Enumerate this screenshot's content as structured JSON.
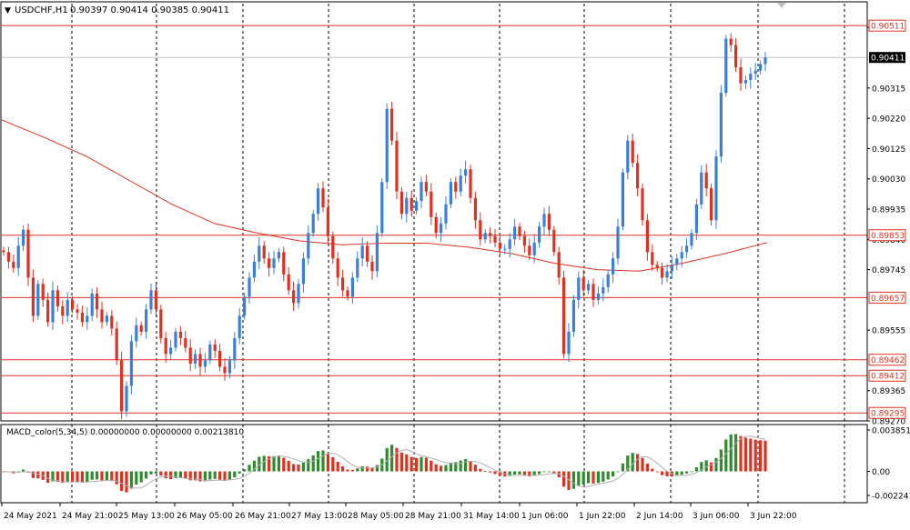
{
  "header": {
    "symbol_label": "USDCHF,H1",
    "ohlc_label": "0.90397 0.90414 0.90385 0.90411"
  },
  "macd": {
    "label": "MACD_color(5,34,5) 0.00000000 0.00000000 0.00213810",
    "ticks": [
      {
        "label": "0.0038515",
        "value": 0.0038515
      },
      {
        "label": "0.00",
        "value": 0.0
      },
      {
        "label": "-0.0022415",
        "value": -0.0022415
      }
    ]
  },
  "colors": {
    "up": "#3b7fd9",
    "down": "#e03020",
    "ma": "#e03020",
    "level": "#e03020",
    "hist_up": "#2e8b2e",
    "hist_down": "#e03020",
    "signal": "#b0b0b0",
    "grid": "#000000"
  },
  "chart_data": {
    "type": "candlestick",
    "ylim": [
      0.8927,
      0.9058
    ],
    "price_ticks": [
      {
        "label": "0.90505",
        "value": 0.90505
      },
      {
        "label": "0.90315",
        "value": 0.90315
      },
      {
        "label": "0.90220",
        "value": 0.9022
      },
      {
        "label": "0.90125",
        "value": 0.90125
      },
      {
        "label": "0.90030",
        "value": 0.9003
      },
      {
        "label": "0.89935",
        "value": 0.89935
      },
      {
        "label": "0.89840",
        "value": 0.8984
      },
      {
        "label": "0.89745",
        "value": 0.89745
      },
      {
        "label": "0.89555",
        "value": 0.89555
      },
      {
        "label": "0.89365",
        "value": 0.89365
      },
      {
        "label": "0.89270",
        "value": 0.8927
      }
    ],
    "levels": [
      {
        "label": "0.90511",
        "value": 0.90511
      },
      {
        "label": "0.89853",
        "value": 0.89853
      },
      {
        "label": "0.89657",
        "value": 0.89657
      },
      {
        "label": "0.89462",
        "value": 0.89462
      },
      {
        "label": "0.89412",
        "value": 0.89412
      },
      {
        "label": "0.89295",
        "value": 0.89295
      }
    ],
    "current_price": {
      "label": "0.90411",
      "value": 0.90411
    },
    "time_labels": [
      "24 May 2021",
      "24 May 21:00",
      "25 May 13:00",
      "26 May 05:00",
      "26 May 21:00",
      "27 May 13:00",
      "28 May 05:00",
      "28 May 21:00",
      "31 May 14:00",
      "1 Jun 06:00",
      "1 Jun 22:00",
      "2 Jun 14:00",
      "3 Jun 06:00",
      "3 Jun 22:00"
    ],
    "closes": [
      0.898,
      0.8977,
      0.8975,
      0.8982,
      0.8987,
      0.8972,
      0.896,
      0.897,
      0.8965,
      0.8958,
      0.8968,
      0.8963,
      0.896,
      0.8965,
      0.8962,
      0.8961,
      0.8958,
      0.896,
      0.8967,
      0.8962,
      0.8958,
      0.896,
      0.8956,
      0.8946,
      0.893,
      0.8938,
      0.8952,
      0.8957,
      0.8955,
      0.8962,
      0.8968,
      0.8962,
      0.8953,
      0.8948,
      0.895,
      0.8955,
      0.8953,
      0.895,
      0.8945,
      0.8948,
      0.8944,
      0.8946,
      0.8951,
      0.8949,
      0.8944,
      0.8942,
      0.8946,
      0.8953,
      0.896,
      0.8966,
      0.8972,
      0.8977,
      0.8982,
      0.8978,
      0.8975,
      0.8978,
      0.898,
      0.8973,
      0.8968,
      0.8964,
      0.897,
      0.8978,
      0.8986,
      0.8992,
      0.9,
      0.8994,
      0.8985,
      0.8978,
      0.8972,
      0.8968,
      0.8966,
      0.8972,
      0.8978,
      0.8982,
      0.8977,
      0.8974,
      0.8986,
      0.9002,
      0.9025,
      0.9015,
      0.8999,
      0.8992,
      0.8997,
      0.8993,
      0.8996,
      0.9002,
      0.8999,
      0.8991,
      0.8986,
      0.8989,
      0.8995,
      0.9002,
      0.8999,
      0.9004,
      0.9006,
      0.8997,
      0.899,
      0.8984,
      0.8986,
      0.8985,
      0.8983,
      0.8981,
      0.8981,
      0.8984,
      0.8988,
      0.8985,
      0.8982,
      0.8979,
      0.8983,
      0.8988,
      0.8992,
      0.8987,
      0.898,
      0.8972,
      0.8948,
      0.8955,
      0.8965,
      0.8972,
      0.8968,
      0.897,
      0.8965,
      0.8967,
      0.8969,
      0.8973,
      0.8978,
      0.8988,
      0.9005,
      0.9015,
      0.9008,
      0.9,
      0.899,
      0.898,
      0.8976,
      0.8975,
      0.8972,
      0.8974,
      0.8976,
      0.8978,
      0.898,
      0.8982,
      0.8986,
      0.8995,
      0.9005,
      0.9,
      0.899,
      0.901,
      0.903,
      0.9047,
      0.9045,
      0.9038,
      0.9033,
      0.9034,
      0.9036,
      0.9037,
      0.9039,
      0.90411
    ],
    "ma": [
      0.90215,
      0.9016,
      0.901,
      0.90025,
      0.8995,
      0.8989,
      0.8986,
      0.89835,
      0.89823,
      0.89828,
      0.89828,
      0.89815,
      0.89795,
      0.89765,
      0.89745,
      0.8974,
      0.89765,
      0.89795,
      0.8983
    ]
  }
}
